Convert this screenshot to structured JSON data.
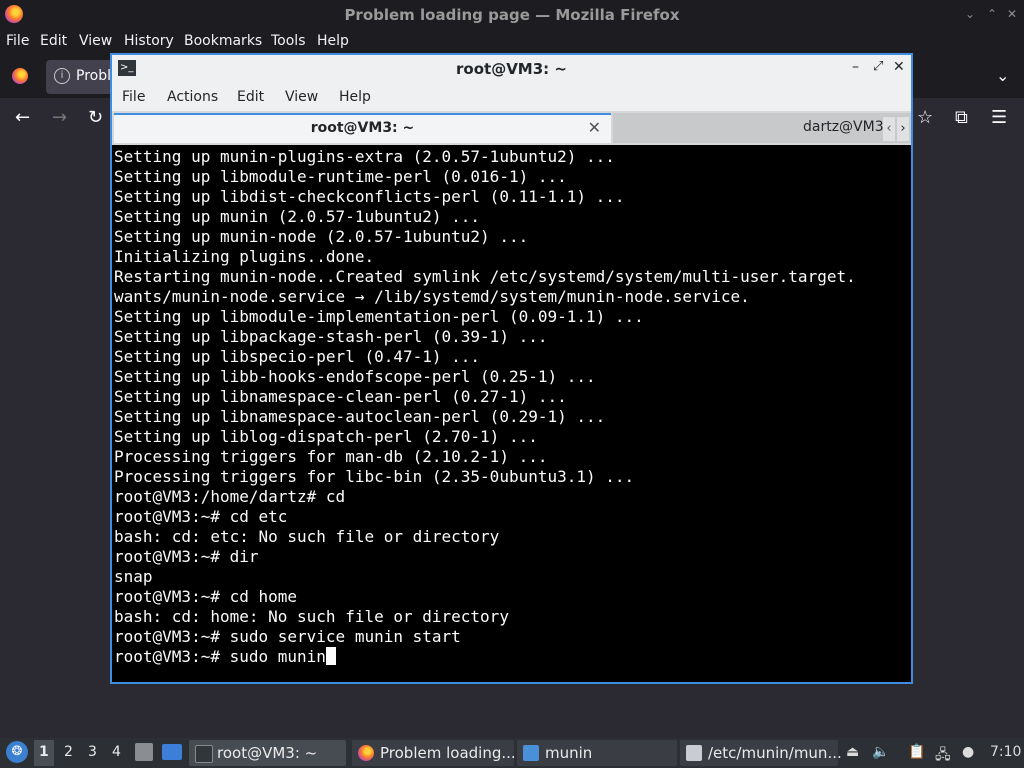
{
  "firefox": {
    "window_title": "Problem loading page — Mozilla Firefox",
    "menu": [
      "File",
      "Edit",
      "View",
      "History",
      "Bookmarks",
      "Tools",
      "Help"
    ],
    "tab_label": "Probl"
  },
  "terminal": {
    "window_title": "root@VM3: ~",
    "menu": [
      "File",
      "Actions",
      "Edit",
      "View",
      "Help"
    ],
    "tabs": [
      {
        "label": "root@VM3: ~",
        "active": true
      },
      {
        "label": "dartz@VM3",
        "active": false
      }
    ],
    "lines": [
      "Setting up munin-plugins-extra (2.0.57-1ubuntu2) ...",
      "Setting up libmodule-runtime-perl (0.016-1) ...",
      "Setting up libdist-checkconflicts-perl (0.11-1.1) ...",
      "Setting up munin (2.0.57-1ubuntu2) ...",
      "Setting up munin-node (2.0.57-1ubuntu2) ...",
      "Initializing plugins..done.",
      "Restarting munin-node..Created symlink /etc/systemd/system/multi-user.target.",
      "wants/munin-node.service → /lib/systemd/system/munin-node.service.",
      "Setting up libmodule-implementation-perl (0.09-1.1) ...",
      "Setting up libpackage-stash-perl (0.39-1) ...",
      "Setting up libspecio-perl (0.47-1) ...",
      "Setting up libb-hooks-endofscope-perl (0.25-1) ...",
      "Setting up libnamespace-clean-perl (0.27-1) ...",
      "Setting up libnamespace-autoclean-perl (0.29-1) ...",
      "Setting up liblog-dispatch-perl (2.70-1) ...",
      "Processing triggers for man-db (2.10.2-1) ...",
      "Processing triggers for libc-bin (2.35-0ubuntu3.1) ...",
      "root@VM3:/home/dartz# cd",
      "root@VM3:~# cd etc",
      "bash: cd: etc: No such file or directory",
      "root@VM3:~# dir",
      "snap",
      "root@VM3:~# cd home",
      "bash: cd: home: No such file or directory",
      "root@VM3:~# sudo service munin start"
    ],
    "prompt_line": "root@VM3:~# sudo munin"
  },
  "panel": {
    "workspaces": [
      "1",
      "2",
      "3",
      "4"
    ],
    "tasks": [
      "root@VM3: ~",
      "Problem loading...",
      "munin",
      "/etc/munin/mun..."
    ],
    "clock": "7:10"
  },
  "colors": {
    "accent": "#3d8ee0",
    "terminal_bg": "#000000",
    "terminal_fg": "#fcfcfc"
  }
}
